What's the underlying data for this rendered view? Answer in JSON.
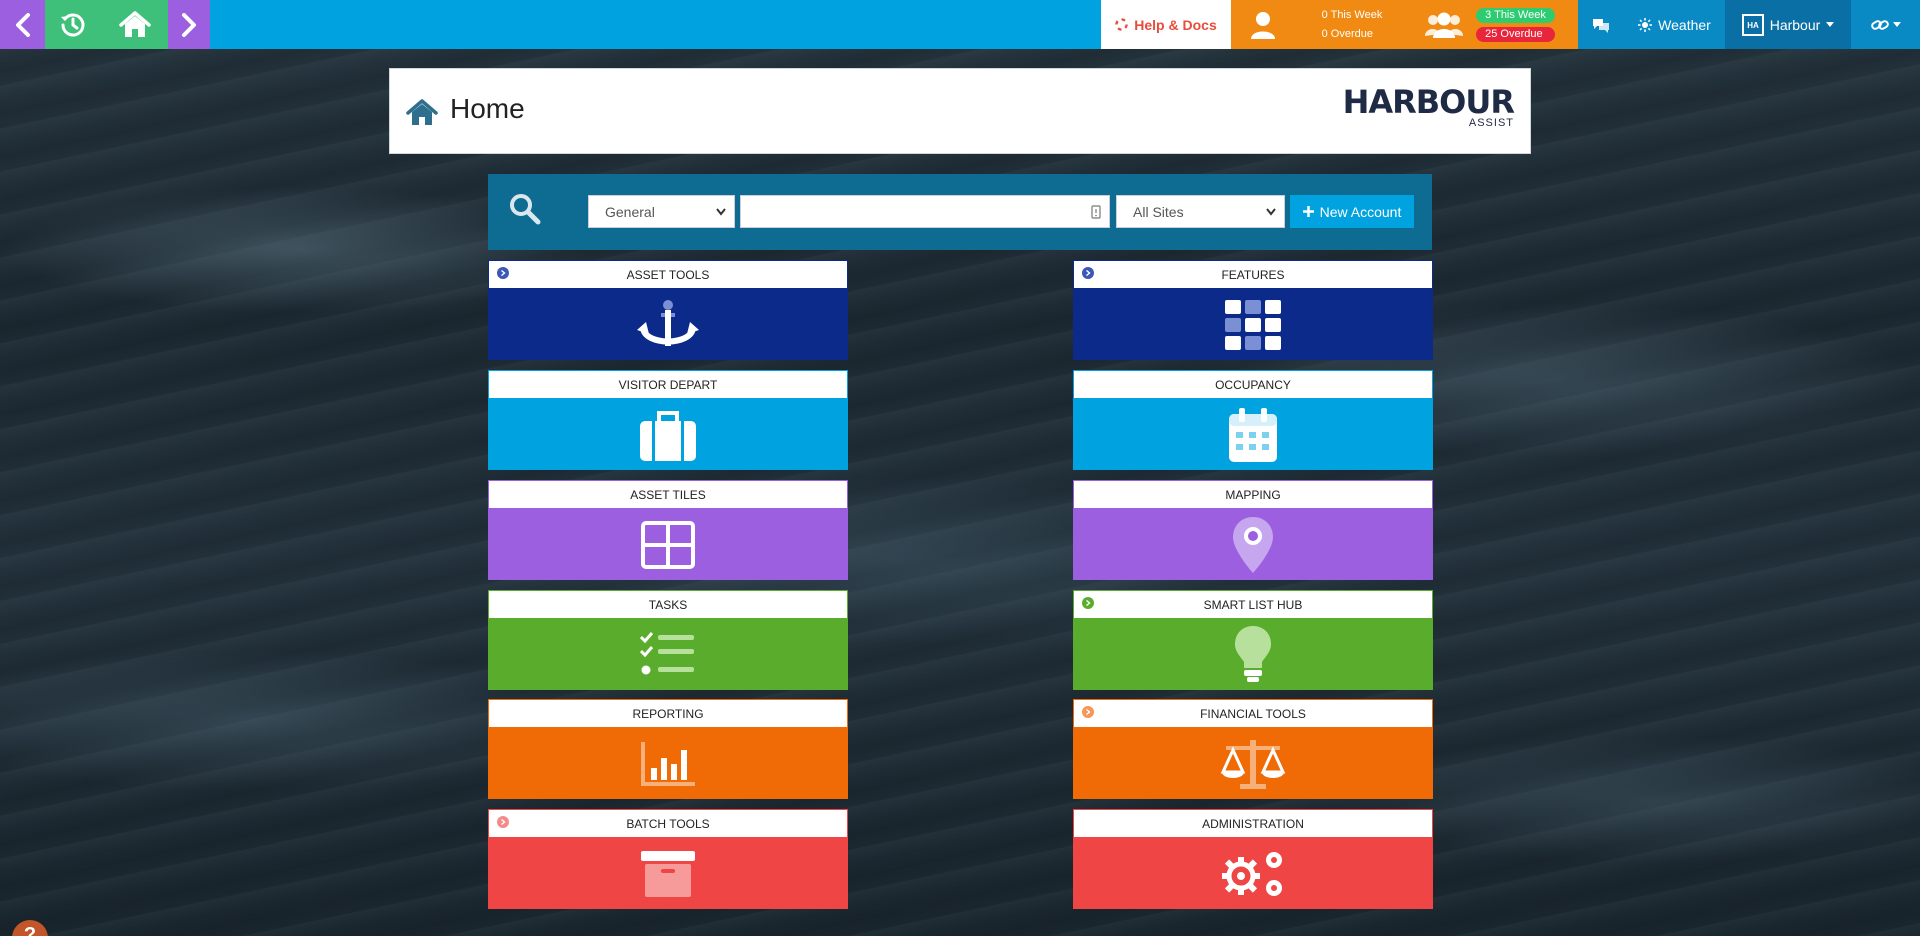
{
  "topbar": {
    "help_label": "Help & Docs",
    "tasks_this_week": "0 This Week",
    "tasks_overdue": "0 Overdue",
    "visits_this_week": "3 This Week",
    "visits_overdue": "25 Overdue",
    "weather_label": "Weather",
    "harbour_label": "Harbour"
  },
  "header": {
    "title": "Home",
    "logo_word": "HARBOUR",
    "logo_sub": "ASSIST"
  },
  "search": {
    "type_selected": "General",
    "query_value": "",
    "site_selected": "All Sites",
    "new_account_label": "New Account"
  },
  "tiles": {
    "asset_tools": "ASSET TOOLS",
    "features": "FEATURES",
    "visitor_depart": "VISITOR DEPART",
    "occupancy": "OCCUPANCY",
    "asset_tiles": "ASSET TILES",
    "mapping": "MAPPING",
    "tasks": "TASKS",
    "smart_list_hub": "SMART LIST HUB",
    "reporting": "REPORTING",
    "financial_tools": "FINANCIAL TOOLS",
    "batch_tools": "BATCH TOOLS",
    "administration": "ADMINISTRATION"
  },
  "help_bubble": "?",
  "colors": {
    "navy": "#0b2a8a",
    "sky": "#00a3e0",
    "purple": "#9c5fdf",
    "green": "#5aad2c",
    "orange": "#f06b05",
    "red": "#f04545"
  }
}
